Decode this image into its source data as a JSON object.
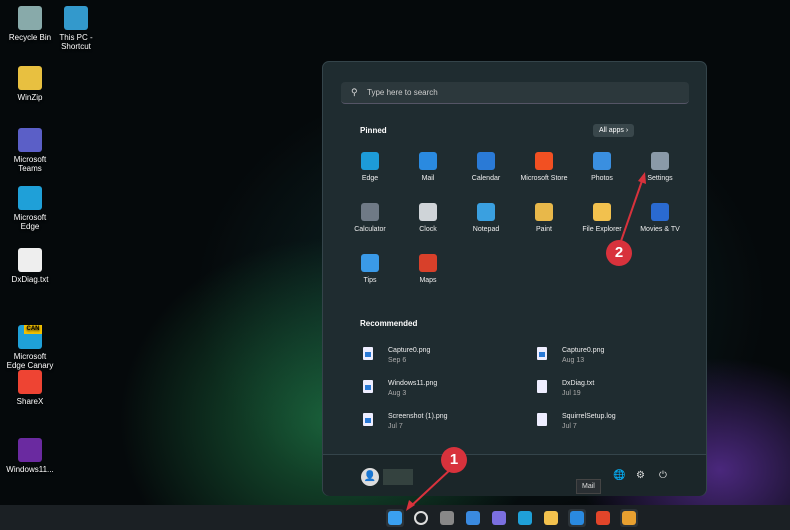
{
  "desktop": {
    "icons": [
      {
        "label": "Recycle Bin",
        "color": "#8aa"
      },
      {
        "label": "This PC - Shortcut",
        "color": "#39c"
      },
      {
        "label": "WinZip",
        "color": "#e8c040"
      },
      {
        "label": "Microsoft Teams",
        "color": "#5b5fc7"
      },
      {
        "label": "Microsoft Edge",
        "color": "#1fa0d8"
      },
      {
        "label": "DxDiag.txt",
        "color": "#eee"
      },
      {
        "label": "Microsoft Edge Canary",
        "color": "#1fa0d8",
        "badge": "CAN"
      },
      {
        "label": "ShareX",
        "color": "#e43"
      },
      {
        "label": "Windows11...",
        "color": "#6a2aa0"
      }
    ]
  },
  "start": {
    "search_placeholder": "Type here to search",
    "pinned_label": "Pinned",
    "all_apps": "All apps",
    "pinned": [
      {
        "label": "Edge",
        "color": "#1d9bd8"
      },
      {
        "label": "Mail",
        "color": "#2a8ae0"
      },
      {
        "label": "Calendar",
        "color": "#2a7ad6"
      },
      {
        "label": "Microsoft Store",
        "color": "#f25022"
      },
      {
        "label": "Photos",
        "color": "#3a8fe0"
      },
      {
        "label": "Settings",
        "color": "#8a9aa8"
      },
      {
        "label": "Calculator",
        "color": "#6f7a86"
      },
      {
        "label": "Clock",
        "color": "#cfd4d8"
      },
      {
        "label": "Notepad",
        "color": "#3aa0e0"
      },
      {
        "label": "Paint",
        "color": "#e8b84a"
      },
      {
        "label": "File Explorer",
        "color": "#f2c14e"
      },
      {
        "label": "Movies & TV",
        "color": "#2a6ad0"
      },
      {
        "label": "Tips",
        "color": "#3a9ae8"
      },
      {
        "label": "Maps",
        "color": "#d8402a"
      }
    ],
    "recommended_label": "Recommended",
    "recommended": [
      {
        "name": "Capture0.png",
        "date": "Sep 6",
        "type": "img"
      },
      {
        "name": "Capture0.png",
        "date": "Aug 13",
        "type": "img"
      },
      {
        "name": "Windows11.png",
        "date": "Aug 3",
        "type": "img"
      },
      {
        "name": "DxDiag.txt",
        "date": "Jul 19",
        "type": "txt"
      },
      {
        "name": "Screenshot (1).png",
        "date": "Jul 7",
        "type": "img"
      },
      {
        "name": "SquirrelSetup.log",
        "date": "Jul 7",
        "type": "txt"
      }
    ]
  },
  "tooltip": "Mail",
  "annotations": [
    "1",
    "2"
  ],
  "taskbar": [
    "start",
    "search",
    "task-view",
    "widgets",
    "chat",
    "edge",
    "file-explorer",
    "mail",
    "maps",
    "chrome-canary"
  ]
}
